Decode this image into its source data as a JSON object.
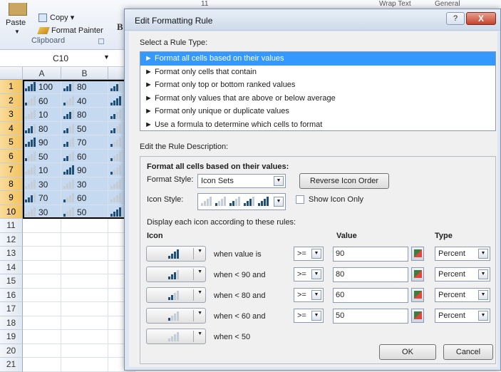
{
  "ribbon": {
    "paste_label": "Paste",
    "copy_label": "Copy ▾",
    "format_painter_label": "Format Painter",
    "clipboard_group": "Clipboard",
    "font_size": "11",
    "wrap_text": "Wrap Text",
    "number_format": "General"
  },
  "formula_bar": {
    "name_box": "C10"
  },
  "sheet": {
    "columns": [
      "A",
      "B"
    ],
    "rows": [
      {
        "n": "1",
        "a": "100",
        "ab": 4,
        "b": "80",
        "bb": 3,
        "c": 3
      },
      {
        "n": "2",
        "a": "60",
        "ab": 1,
        "b": "40",
        "bb": 1,
        "c": 4,
        "cv": "1"
      },
      {
        "n": "3",
        "a": "10",
        "ab": 0,
        "b": "80",
        "bb": 3,
        "c": 2
      },
      {
        "n": "4",
        "a": "80",
        "ab": 3,
        "b": "50",
        "bb": 2,
        "c": 2
      },
      {
        "n": "5",
        "a": "90",
        "ab": 4,
        "b": "70",
        "bb": 2,
        "c": 1
      },
      {
        "n": "6",
        "a": "50",
        "ab": 1,
        "b": "60",
        "bb": 2,
        "c": 1
      },
      {
        "n": "7",
        "a": "10",
        "ab": 0,
        "b": "90",
        "bb": 4,
        "c": 1
      },
      {
        "n": "8",
        "a": "30",
        "ab": 0,
        "b": "30",
        "bb": 0,
        "c": 0
      },
      {
        "n": "9",
        "a": "70",
        "ab": 3,
        "b": "60",
        "bb": 1,
        "c": 0
      },
      {
        "n": "10",
        "a": "30",
        "ab": 0,
        "b": "50",
        "bb": 1,
        "c": 4,
        "cv": "1"
      },
      {
        "n": "11"
      },
      {
        "n": "12"
      },
      {
        "n": "13"
      },
      {
        "n": "14"
      },
      {
        "n": "15"
      },
      {
        "n": "16"
      },
      {
        "n": "17"
      },
      {
        "n": "18"
      },
      {
        "n": "19"
      },
      {
        "n": "20"
      },
      {
        "n": "21"
      }
    ]
  },
  "dialog": {
    "title": "Edit Formatting Rule",
    "help": "?",
    "close": "X",
    "select_rule_type_label": "Select a Rule Type:",
    "rule_types": [
      "► Format all cells based on their values",
      "► Format only cells that contain",
      "► Format only top or bottom ranked values",
      "► Format only values that are above or below average",
      "► Format only unique or duplicate values",
      "► Use a formula to determine which cells to format"
    ],
    "edit_desc_label": "Edit the Rule Description:",
    "desc_heading": "Format all cells based on their values:",
    "format_style_label": "Format Style:",
    "format_style_value": "Icon Sets",
    "reverse_btn": "Reverse Icon Order",
    "icon_style_label": "Icon Style:",
    "show_icon_only": "Show Icon Only",
    "display_rules_label": "Display each icon according to these rules:",
    "col_icon": "Icon",
    "col_value": "Value",
    "col_type": "Type",
    "rules": [
      {
        "when": "when value is",
        "op": ">=",
        "value": "90",
        "type": "Percent",
        "bars": 4
      },
      {
        "when": "when < 90 and",
        "op": ">=",
        "value": "80",
        "type": "Percent",
        "bars": 3
      },
      {
        "when": "when < 80 and",
        "op": ">=",
        "value": "60",
        "type": "Percent",
        "bars": 2
      },
      {
        "when": "when < 60 and",
        "op": ">=",
        "value": "50",
        "type": "Percent",
        "bars": 1
      },
      {
        "when": "when < 50",
        "bars": 0
      }
    ],
    "ok": "OK",
    "cancel": "Cancel"
  },
  "colors": {
    "accent": "#3399ff",
    "bar_on": "#1f4e79",
    "bar_off": "#c4ccd6",
    "selection": "#c5d9f1"
  }
}
